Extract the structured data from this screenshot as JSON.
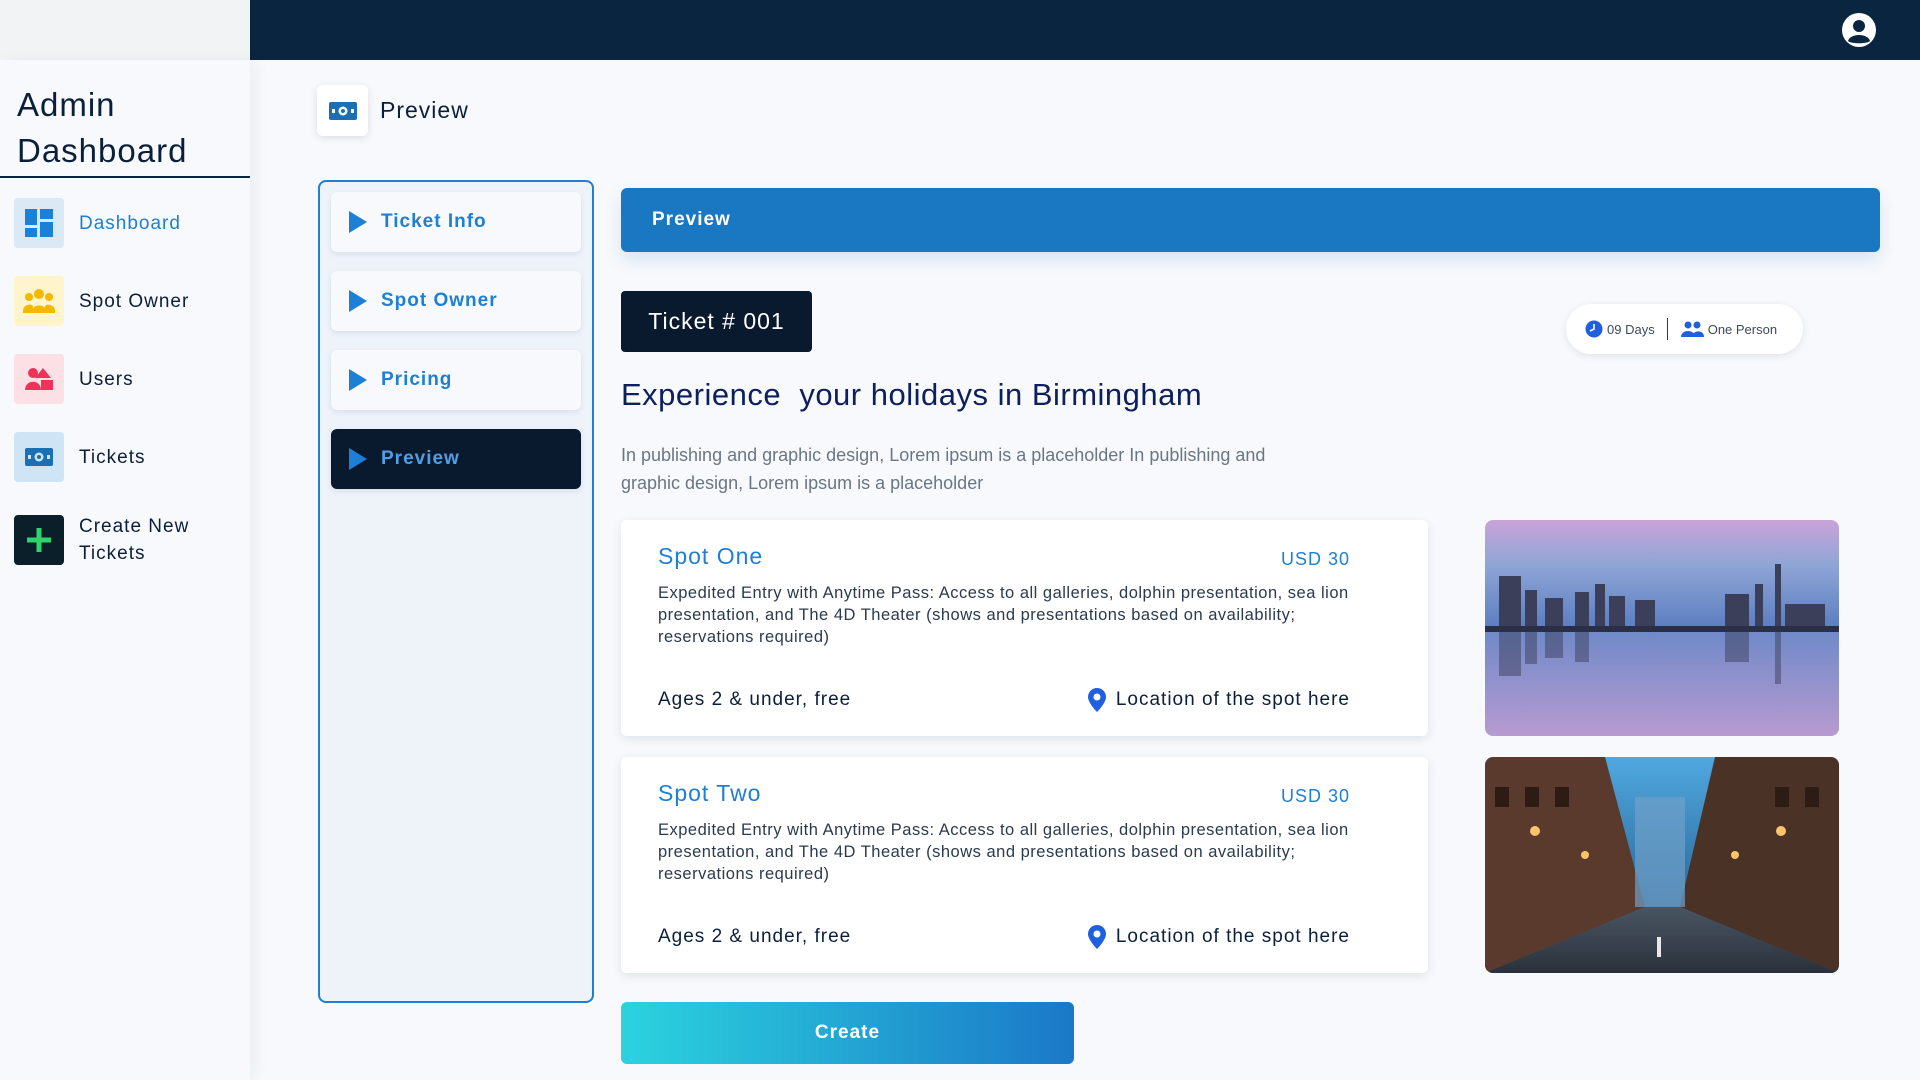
{
  "app": {
    "brand_line1": "Admin",
    "brand_line2": "Dashboard"
  },
  "sidebar": {
    "items": [
      {
        "label": "Dashboard",
        "icon": "dashboard-grid-icon",
        "active": true
      },
      {
        "label": "Spot Owner",
        "icon": "group-icon"
      },
      {
        "label": "Users",
        "icon": "users-icon"
      },
      {
        "label": "Tickets",
        "icon": "ticket-icon"
      },
      {
        "label_line1": "Create New",
        "label_line2": "Tickets",
        "icon": "plus-icon"
      }
    ]
  },
  "header": {
    "title": "Preview",
    "icon": "ticket-icon"
  },
  "steps": [
    {
      "label": "Ticket Info"
    },
    {
      "label": "Spot Owner"
    },
    {
      "label": "Pricing"
    },
    {
      "label": "Preview",
      "active": true
    }
  ],
  "preview": {
    "banner": "Preview",
    "ticket_number": "Ticket # 001",
    "duration": "09 Days",
    "persons": "One Person",
    "headline": "Experience  your holidays in Birmingham",
    "description": "In publishing and graphic design, Lorem ipsum is a placeholder In publishing and graphic design, Lorem ipsum is a placeholder"
  },
  "spots": [
    {
      "name": "Spot One",
      "price": "USD 30",
      "description": "Expedited Entry with Anytime Pass: Access to all galleries, dolphin presentation, sea lion presentation, and The 4D Theater (shows and presentations based on availability; reservations required)",
      "ages": "Ages 2 & under, free",
      "location": "Location of the spot here"
    },
    {
      "name": "Spot Two",
      "price": "USD 30",
      "description": "Expedited Entry with Anytime Pass: Access to all galleries, dolphin presentation, sea lion presentation, and The 4D Theater (shows and presentations based on availability; reservations required)",
      "ages": "Ages 2 & under, free",
      "location": "Location of the spot here"
    }
  ],
  "actions": {
    "create_label": "Create"
  },
  "colors": {
    "navy": "#0a2540",
    "accent_blue": "#1e7fd6",
    "banner_blue": "#1a78c2",
    "dark": "#0a1a2e"
  }
}
